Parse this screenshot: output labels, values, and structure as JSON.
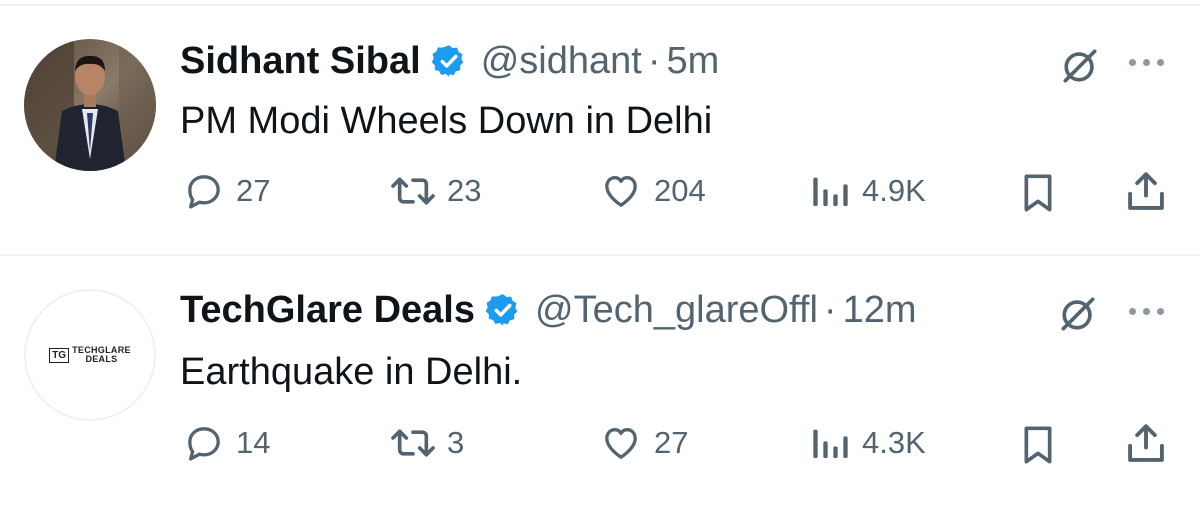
{
  "tweets": [
    {
      "name": "Sidhant Sibal",
      "verified": true,
      "handle": "@sidhant",
      "separator": "·",
      "time": "5m",
      "text": "PM Modi Wheels Down in Delhi",
      "avatar": "photo-avatar",
      "replies": "27",
      "reposts": "23",
      "likes": "204",
      "views": "4.9K"
    },
    {
      "name": "TechGlare Deals",
      "verified": true,
      "handle": "@Tech_glareOffl",
      "separator": "·",
      "time": "12m",
      "text": "Earthquake in Delhi.",
      "avatar": "logo-avatar",
      "avatar_logo_mark": "TG",
      "avatar_logo_text_1": "TECHGLARE",
      "avatar_logo_text_2": "DEALS",
      "replies": "14",
      "reposts": "3",
      "likes": "27",
      "views": "4.3K"
    }
  ],
  "colors": {
    "primary_text": "#0f1419",
    "secondary_text": "#536471",
    "verified_blue": "#1d9bf0",
    "divider": "#eff3f4"
  },
  "icons": [
    "reply-icon",
    "repost-icon",
    "like-icon",
    "views-icon",
    "bookmark-icon",
    "share-icon",
    "grok-icon",
    "more-icon",
    "verified-badge-icon"
  ]
}
